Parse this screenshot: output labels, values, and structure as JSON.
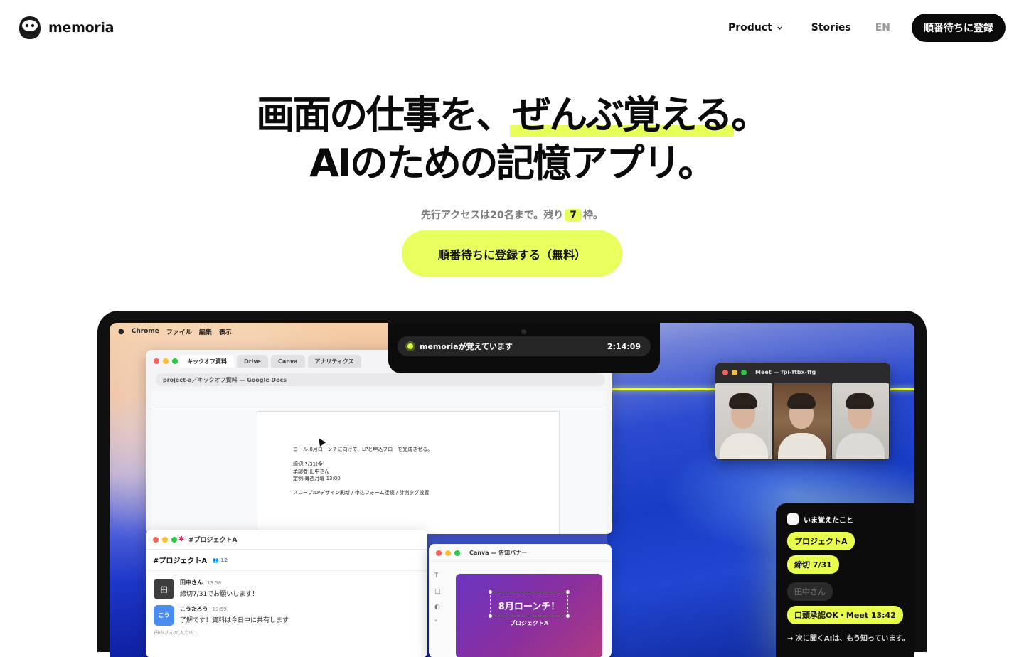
{
  "brand": {
    "name": "memoria"
  },
  "nav": {
    "product": "Product",
    "stories": "Stories",
    "lang": "EN",
    "cta": "順番待ちに登録"
  },
  "hero": {
    "line1_a": "画面の仕事を、",
    "line1_b": "ぜんぶ覚える",
    "line1_c": "。",
    "line2": "AIのための記憶アプリ。",
    "sub_a": "先行アクセスは20名まで。残り",
    "sub_count": "7",
    "sub_b": "枠。",
    "cta": "順番待ちに登録する（無料）"
  },
  "screen": {
    "menubar": [
      "Chrome",
      "ファイル",
      "編集",
      "表示"
    ],
    "recording": {
      "label": "memoriaが覚えています",
      "time": "2:14:09"
    },
    "chrome": {
      "tabs": [
        "キックオフ資料",
        "Drive",
        "Canva",
        "アナリティクス"
      ],
      "url": "project-a／キックオフ資料 — Google Docs",
      "doc": [
        "ゴール:8月ローンチに向けて、LPと申込フローを完成させる。",
        "締切:7/31(金)",
        "承認者:田中さん",
        "定例:毎週月曜 13:00",
        "スコープ:LPデザイン刷新 / 申込フォーム接続 / 計測タグ設置"
      ]
    },
    "slack": {
      "title": "#プロジェクトA",
      "channel": "#プロジェクトA",
      "members": "👥 12",
      "messages": [
        {
          "avatar": "田",
          "name": "田中さん",
          "time": "13:58",
          "text": "締切7/31でお願いします！",
          "color": "#3d3d3d"
        },
        {
          "avatar": "こう",
          "name": "こうたろう",
          "time": "13:59",
          "text": "了解です！資料は今日中に共有します",
          "color": "#4a8cf0"
        }
      ],
      "typing": "田中さんが入力中..."
    },
    "canva": {
      "title": "Canva — 告知バナー",
      "tools": [
        "T",
        "□",
        "◐",
        "\""
      ],
      "banner_title": "8月ローンチ！",
      "banner_sub": "プロジェクトA"
    },
    "meet": {
      "title": "Meet — fpi-ftbx-ffg"
    },
    "memory": {
      "title": "いま覚えたこと",
      "chips": [
        "プロジェクトA",
        "締切 7/31"
      ],
      "dim_chip": "田中さん",
      "chip_last": "口頭承認OK・Meet 13:42",
      "footer": "→ 次に聞くAIは、もう知っています。"
    }
  },
  "colors": {
    "accent": "#e9ff5e",
    "dark": "#0a0a0a"
  }
}
